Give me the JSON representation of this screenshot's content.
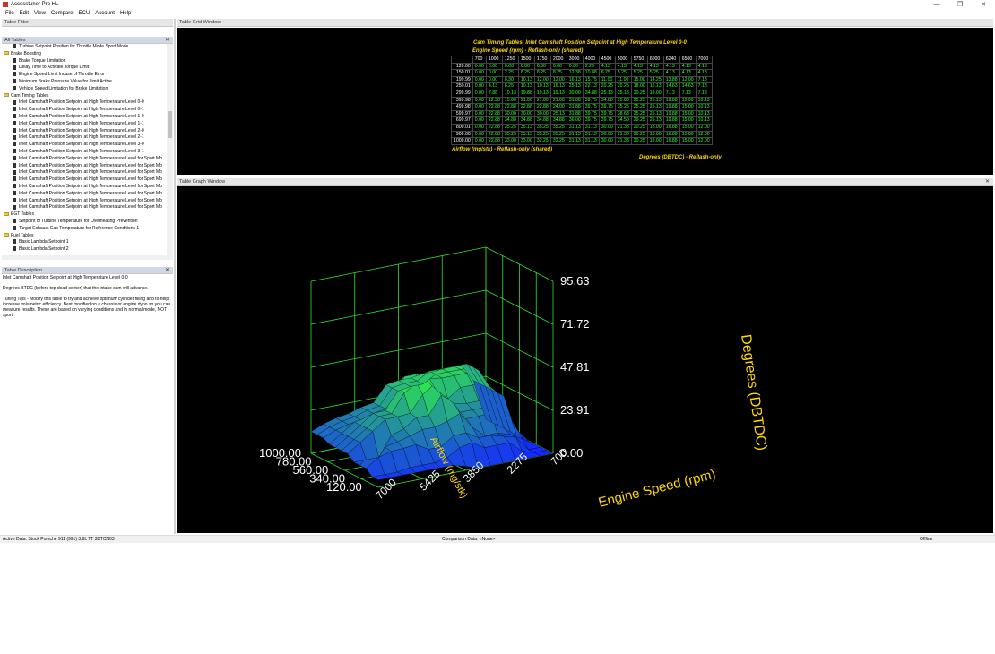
{
  "app": {
    "title": "Accesstuner Pro HL",
    "menu": [
      "File",
      "Edit",
      "View",
      "Compare",
      "ECU",
      "Account",
      "Help"
    ],
    "window_controls": [
      "—",
      "❐",
      "✕"
    ]
  },
  "left": {
    "table_filter_label": "Table Filter",
    "all_tables_label": "All Tables",
    "tree": [
      {
        "type": "item",
        "label": "Turbine Setpoint Position for Throttle Mode Sport Mode"
      },
      {
        "type": "folder",
        "label": "Brake Boosting"
      },
      {
        "type": "item",
        "label": "Brake Torque Limitation"
      },
      {
        "type": "item",
        "label": "Delay Time to Activate Torque Limit"
      },
      {
        "type": "item",
        "label": "Engine Speed Limit Incase of Throttle Error"
      },
      {
        "type": "item",
        "label": "Minimum Brake Pressure Value for Limit Active"
      },
      {
        "type": "item",
        "label": "Vehicle Speed Limitation for Brake Limitation"
      },
      {
        "type": "folder",
        "label": "Cam Timing Tables"
      },
      {
        "type": "item",
        "label": "Inlet Camshaft Position Setpoint at High Temperature Level 0-0"
      },
      {
        "type": "item",
        "label": "Inlet Camshaft Position Setpoint at High Temperature Level 0-1"
      },
      {
        "type": "item",
        "label": "Inlet Camshaft Position Setpoint at High Temperature Level 1-0"
      },
      {
        "type": "item",
        "label": "Inlet Camshaft Position Setpoint at High Temperature Level 1-1"
      },
      {
        "type": "item",
        "label": "Inlet Camshaft Position Setpoint at High Temperature Level 2-0"
      },
      {
        "type": "item",
        "label": "Inlet Camshaft Position Setpoint at High Temperature Level 2-1"
      },
      {
        "type": "item",
        "label": "Inlet Camshaft Position Setpoint at High Temperature Level 3-0"
      },
      {
        "type": "item",
        "label": "Inlet Camshaft Position Setpoint at High Temperature Level 3-1"
      },
      {
        "type": "item",
        "label": "Inlet Camshaft Position Setpoint at High Temperature Level for Sport Mo"
      },
      {
        "type": "item",
        "label": "Inlet Camshaft Position Setpoint at High Temperature Level for Sport Mo"
      },
      {
        "type": "item",
        "label": "Inlet Camshaft Position Setpoint at High Temperature Level for Sport Mo"
      },
      {
        "type": "item",
        "label": "Inlet Camshaft Position Setpoint at High Temperature Level for Sport Mo"
      },
      {
        "type": "item",
        "label": "Inlet Camshaft Position Setpoint at High Temperature Level for Sport Mo"
      },
      {
        "type": "item",
        "label": "Inlet Camshaft Position Setpoint at High Temperature Level for Sport Mo"
      },
      {
        "type": "item",
        "label": "Inlet Camshaft Position Setpoint at High Temperature Level for Sport Mo"
      },
      {
        "type": "item",
        "label": "Inlet Camshaft Position Setpoint at High Temperature Level for Sport Mo"
      },
      {
        "type": "folder",
        "label": "EGT Tables"
      },
      {
        "type": "item",
        "label": "Setpoint of Turbine Temperature for Overheating Prevention"
      },
      {
        "type": "item",
        "label": "Target Exhaust Gas Temperature for Reference Conditions 1"
      },
      {
        "type": "folder",
        "label": "Fuel Tables"
      },
      {
        "type": "item",
        "label": "Basic Lambda Setpoint 1"
      },
      {
        "type": "item",
        "label": "Basic Lambda Setpoint 2"
      }
    ],
    "description_label": "Table Description",
    "description": [
      "Inlet Camshaft Position Setpoint at High Temperature Level 0-0",
      "Degrees BTDC (before top dead center) that the intake cam will advance.",
      "Tuning Tips - Modify this table to try and achieve optimum cylinder filling and to help increase volumetric efficiency. Best modified on a chassis or engine dyno so you can measure results. These are based on varying conditions and in normal mode, NOT sport."
    ]
  },
  "grid_window": {
    "label": "Table Grid Window",
    "title": "Cam Timing Tables: Inlet Camshaft Position Setpoint at High Temperature Level 0-0",
    "col_axis": "Engine Speed (rpm) - Reflash-only (shared)",
    "row_axis": "Airflow (mg/stk) - Reflash-only (shared)",
    "value_unit": "Degrees (DBTDC) - Reflash-only",
    "columns": [
      "700",
      "1000",
      "1250",
      "1500",
      "1750",
      "2000",
      "3000",
      "4000",
      "4500",
      "5000",
      "5750",
      "6000",
      "6240",
      "6500",
      "7000"
    ],
    "rows": [
      {
        "h": "120.00",
        "v": [
          "0.00",
          "0.00",
          "0.00",
          "0.00",
          "0.00",
          "0.00",
          "0.00",
          "2.25",
          "4.13",
          "4.13",
          "4.13",
          "4.13",
          "4.13",
          "4.13",
          "4.13"
        ]
      },
      {
        "h": "150.01",
        "v": [
          "0.00",
          "0.00",
          "2.25",
          "8.25",
          "8.25",
          "8.25",
          "12.38",
          "10.88",
          "6.75",
          "5.25",
          "5.25",
          "5.25",
          "4.13",
          "4.13",
          "4.13"
        ]
      },
      {
        "h": "199.99",
        "v": [
          "0.00",
          "0.00",
          "8.30",
          "10.13",
          "12.00",
          "12.00",
          "16.13",
          "15.75",
          "11.00",
          "11.00",
          "15.00",
          "14.25",
          "13.88",
          "12.00",
          "7.13"
        ]
      },
      {
        "h": "250.01",
        "v": [
          "0.00",
          "4.13",
          "8.25",
          "10.13",
          "10.13",
          "16.13",
          "25.13",
          "22.13",
          "20.25",
          "20.25",
          "18.00",
          "16.13",
          "14.63",
          "14.63",
          "7.13"
        ]
      },
      {
        "h": "299.99",
        "v": [
          "0.00",
          "7.88",
          "10.13",
          "19.88",
          "19.13",
          "19.13",
          "30.00",
          "34.88",
          "25.13",
          "25.13",
          "20.25",
          "18.00",
          "7.13",
          "7.13",
          "7.13"
        ]
      },
      {
        "h": "399.98",
        "v": [
          "0.00",
          "12.38",
          "15.00",
          "21.00",
          "21.00",
          "21.00",
          "31.88",
          "39.75",
          "34.88",
          "25.88",
          "25.25",
          "25.13",
          "19.88",
          "15.00",
          "10.13"
        ]
      },
      {
        "h": "499.98",
        "v": [
          "0.00",
          "22.88",
          "22.88",
          "22.88",
          "22.88",
          "24.00",
          "31.88",
          "39.75",
          "39.75",
          "35.25",
          "25.25",
          "25.13",
          "19.88",
          "15.00",
          "10.13"
        ]
      },
      {
        "h": "599.97",
        "v": [
          "0.00",
          "22.88",
          "30.00",
          "30.00",
          "30.00",
          "25.13",
          "31.88",
          "39.75",
          "39.75",
          "38.63",
          "25.25",
          "25.13",
          "19.88",
          "15.00",
          "10.13"
        ]
      },
      {
        "h": "699.97",
        "v": [
          "0.00",
          "22.88",
          "34.88",
          "34.88",
          "34.88",
          "34.88",
          "36.00",
          "39.75",
          "39.75",
          "34.50",
          "29.25",
          "25.13",
          "19.88",
          "15.00",
          "10.13"
        ]
      },
      {
        "h": "800.01",
        "v": [
          "0.00",
          "22.88",
          "35.25",
          "35.13",
          "35.25",
          "35.25",
          "31.13",
          "31.13",
          "30.00",
          "21.38",
          "20.25",
          "18.00",
          "16.88",
          "15.00",
          "12.00"
        ]
      },
      {
        "h": "900.00",
        "v": [
          "0.00",
          "22.88",
          "35.25",
          "35.13",
          "35.25",
          "35.25",
          "31.13",
          "31.13",
          "30.00",
          "21.38",
          "20.25",
          "18.00",
          "16.88",
          "15.00",
          "12.00"
        ]
      },
      {
        "h": "1000.00",
        "v": [
          "0.00",
          "22.88",
          "33.00",
          "33.00",
          "32.25",
          "32.25",
          "31.13",
          "31.13",
          "30.00",
          "21.38",
          "20.25",
          "18.00",
          "16.88",
          "15.00",
          "12.00"
        ]
      }
    ]
  },
  "graph_window": {
    "label": "Table Graph Window",
    "z_ticks": [
      "95.63",
      "71.72",
      "47.81",
      "23.91",
      "0.00"
    ],
    "z_label": "Degrees (DBTDC)",
    "x_label": "Engine Speed (rpm)",
    "x_ticks": [
      "7000",
      "5425",
      "3850",
      "2275",
      "700"
    ],
    "y_label": "Airflow (mg/stk)",
    "y_ticks": [
      "1000.00",
      "780.00",
      "560.00",
      "340.00",
      "120.00"
    ]
  },
  "status": {
    "active_data": "Active Data: Stock Porsche 911 (991) 3.8L TT 3BTCN03",
    "comparison": "Comparison Data: <None>",
    "online": "Offline"
  },
  "colors": {
    "accent_yellow": "#ffd800",
    "grid_values": "#33ff33",
    "surface_low": "#1a2cff",
    "surface_high": "#33ff33"
  }
}
